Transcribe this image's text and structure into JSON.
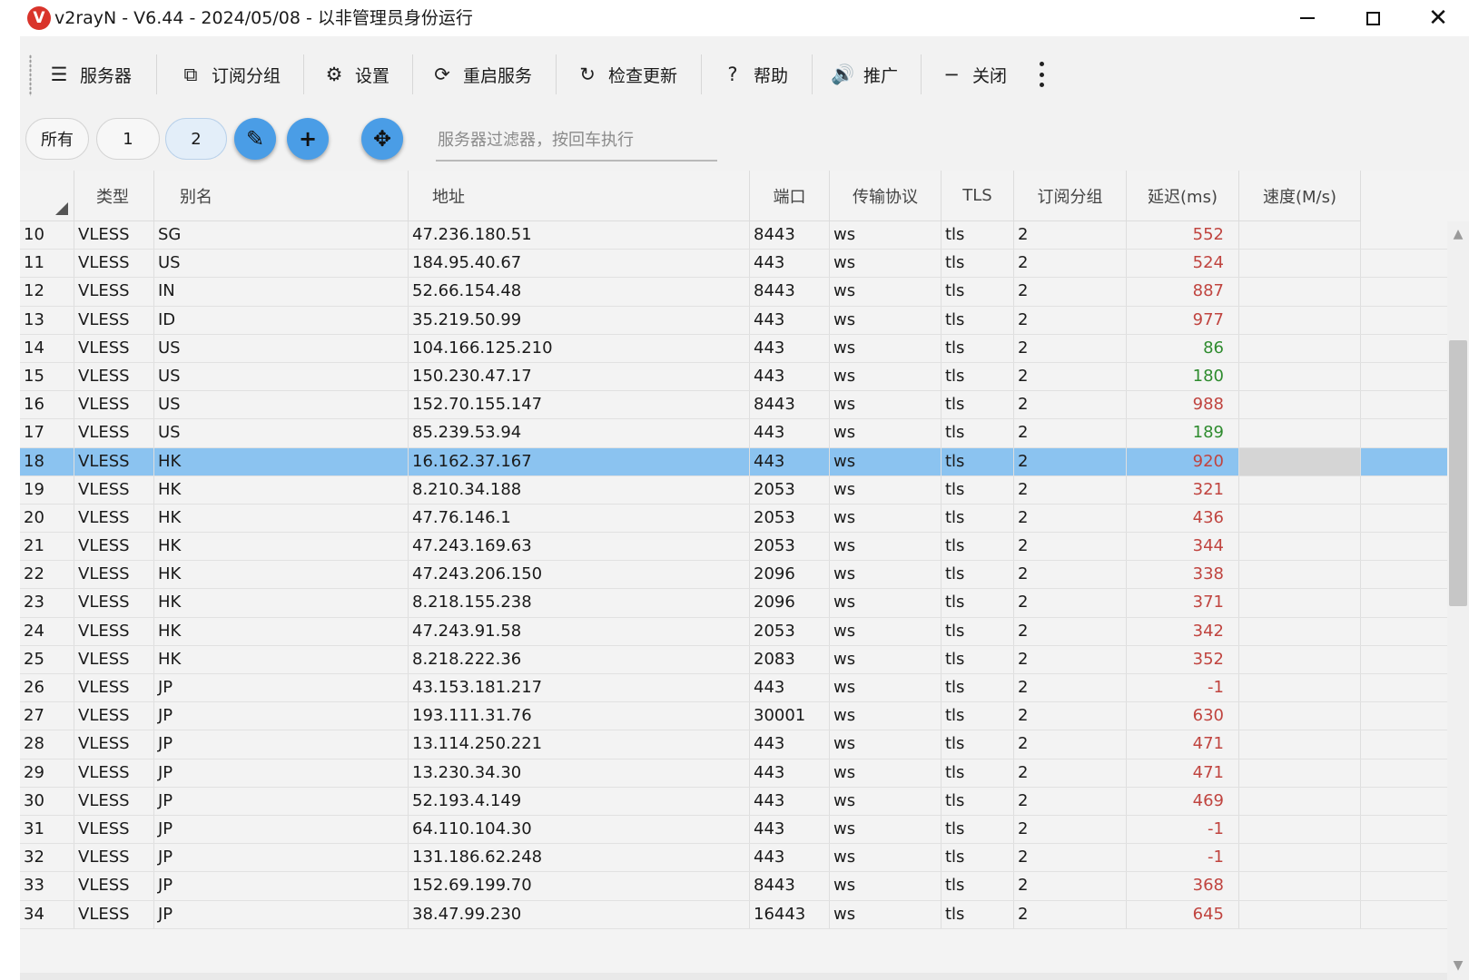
{
  "window": {
    "logo_letter": "V",
    "title": "v2rayN - V6.44 - 2024/05/08 - 以非管理员身份运行",
    "minimize_glyph": "",
    "close_glyph": "✕"
  },
  "toolbar": {
    "items": [
      {
        "icon": "server-list-icon",
        "glyph": "☰",
        "label": "服务器"
      },
      {
        "icon": "subscription-icon",
        "glyph": "⧉",
        "label": "订阅分组"
      },
      {
        "icon": "gear-icon",
        "glyph": "⚙",
        "label": "设置"
      },
      {
        "icon": "restart-icon",
        "glyph": "⟳",
        "label": "重启服务"
      },
      {
        "icon": "check-update-icon",
        "glyph": "↻",
        "label": "检查更新"
      },
      {
        "icon": "help-icon",
        "glyph": "?",
        "label": "帮助"
      },
      {
        "icon": "speaker-icon",
        "glyph": "🔊",
        "label": "推广"
      },
      {
        "icon": "minus-icon",
        "glyph": "−",
        "label": "关闭"
      }
    ],
    "more_icon": "more-vertical-icon"
  },
  "filters": {
    "chips": [
      "所有",
      "1",
      "2"
    ],
    "active_chip": "2",
    "edit_glyph": "✎",
    "add_glyph": "+",
    "move_glyph": "✥",
    "search_placeholder": "服务器过滤器，按回车执行",
    "search_value": ""
  },
  "table": {
    "columns": [
      "",
      "类型",
      "别名",
      "地址",
      "端口",
      "传输协议",
      "TLS",
      "订阅分组",
      "延迟(ms)",
      "速度(M/s)"
    ],
    "selected_index": "18",
    "rows": [
      {
        "idx": "10",
        "type": "VLESS",
        "alias": "SG",
        "address": "47.236.180.51",
        "port": "8443",
        "transport": "ws",
        "tls": "tls",
        "group": "2",
        "delay": "552",
        "speed": ""
      },
      {
        "idx": "11",
        "type": "VLESS",
        "alias": "US",
        "address": "184.95.40.67",
        "port": "443",
        "transport": "ws",
        "tls": "tls",
        "group": "2",
        "delay": "524",
        "speed": ""
      },
      {
        "idx": "12",
        "type": "VLESS",
        "alias": "IN",
        "address": "52.66.154.48",
        "port": "8443",
        "transport": "ws",
        "tls": "tls",
        "group": "2",
        "delay": "887",
        "speed": ""
      },
      {
        "idx": "13",
        "type": "VLESS",
        "alias": "ID",
        "address": "35.219.50.99",
        "port": "443",
        "transport": "ws",
        "tls": "tls",
        "group": "2",
        "delay": "977",
        "speed": ""
      },
      {
        "idx": "14",
        "type": "VLESS",
        "alias": "US",
        "address": "104.166.125.210",
        "port": "443",
        "transport": "ws",
        "tls": "tls",
        "group": "2",
        "delay": "86",
        "speed": ""
      },
      {
        "idx": "15",
        "type": "VLESS",
        "alias": "US",
        "address": "150.230.47.17",
        "port": "443",
        "transport": "ws",
        "tls": "tls",
        "group": "2",
        "delay": "180",
        "speed": ""
      },
      {
        "idx": "16",
        "type": "VLESS",
        "alias": "US",
        "address": "152.70.155.147",
        "port": "8443",
        "transport": "ws",
        "tls": "tls",
        "group": "2",
        "delay": "988",
        "speed": ""
      },
      {
        "idx": "17",
        "type": "VLESS",
        "alias": "US",
        "address": "85.239.53.94",
        "port": "443",
        "transport": "ws",
        "tls": "tls",
        "group": "2",
        "delay": "189",
        "speed": ""
      },
      {
        "idx": "18",
        "type": "VLESS",
        "alias": "HK",
        "address": "16.162.37.167",
        "port": "443",
        "transport": "ws",
        "tls": "tls",
        "group": "2",
        "delay": "920",
        "speed": ""
      },
      {
        "idx": "19",
        "type": "VLESS",
        "alias": "HK",
        "address": "8.210.34.188",
        "port": "2053",
        "transport": "ws",
        "tls": "tls",
        "group": "2",
        "delay": "321",
        "speed": ""
      },
      {
        "idx": "20",
        "type": "VLESS",
        "alias": "HK",
        "address": "47.76.146.1",
        "port": "2053",
        "transport": "ws",
        "tls": "tls",
        "group": "2",
        "delay": "436",
        "speed": ""
      },
      {
        "idx": "21",
        "type": "VLESS",
        "alias": "HK",
        "address": "47.243.169.63",
        "port": "2053",
        "transport": "ws",
        "tls": "tls",
        "group": "2",
        "delay": "344",
        "speed": ""
      },
      {
        "idx": "22",
        "type": "VLESS",
        "alias": "HK",
        "address": "47.243.206.150",
        "port": "2096",
        "transport": "ws",
        "tls": "tls",
        "group": "2",
        "delay": "338",
        "speed": ""
      },
      {
        "idx": "23",
        "type": "VLESS",
        "alias": "HK",
        "address": "8.218.155.238",
        "port": "2096",
        "transport": "ws",
        "tls": "tls",
        "group": "2",
        "delay": "371",
        "speed": ""
      },
      {
        "idx": "24",
        "type": "VLESS",
        "alias": "HK",
        "address": "47.243.91.58",
        "port": "2053",
        "transport": "ws",
        "tls": "tls",
        "group": "2",
        "delay": "342",
        "speed": ""
      },
      {
        "idx": "25",
        "type": "VLESS",
        "alias": "HK",
        "address": "8.218.222.36",
        "port": "2083",
        "transport": "ws",
        "tls": "tls",
        "group": "2",
        "delay": "352",
        "speed": ""
      },
      {
        "idx": "26",
        "type": "VLESS",
        "alias": "JP",
        "address": "43.153.181.217",
        "port": "443",
        "transport": "ws",
        "tls": "tls",
        "group": "2",
        "delay": "-1",
        "speed": ""
      },
      {
        "idx": "27",
        "type": "VLESS",
        "alias": "JP",
        "address": "193.111.31.76",
        "port": "30001",
        "transport": "ws",
        "tls": "tls",
        "group": "2",
        "delay": "630",
        "speed": ""
      },
      {
        "idx": "28",
        "type": "VLESS",
        "alias": "JP",
        "address": "13.114.250.221",
        "port": "443",
        "transport": "ws",
        "tls": "tls",
        "group": "2",
        "delay": "471",
        "speed": ""
      },
      {
        "idx": "29",
        "type": "VLESS",
        "alias": "JP",
        "address": "13.230.34.30",
        "port": "443",
        "transport": "ws",
        "tls": "tls",
        "group": "2",
        "delay": "471",
        "speed": ""
      },
      {
        "idx": "30",
        "type": "VLESS",
        "alias": "JP",
        "address": "52.193.4.149",
        "port": "443",
        "transport": "ws",
        "tls": "tls",
        "group": "2",
        "delay": "469",
        "speed": ""
      },
      {
        "idx": "31",
        "type": "VLESS",
        "alias": "JP",
        "address": "64.110.104.30",
        "port": "443",
        "transport": "ws",
        "tls": "tls",
        "group": "2",
        "delay": "-1",
        "speed": ""
      },
      {
        "idx": "32",
        "type": "VLESS",
        "alias": "JP",
        "address": "131.186.62.248",
        "port": "443",
        "transport": "ws",
        "tls": "tls",
        "group": "2",
        "delay": "-1",
        "speed": ""
      },
      {
        "idx": "33",
        "type": "VLESS",
        "alias": "JP",
        "address": "152.69.199.70",
        "port": "8443",
        "transport": "ws",
        "tls": "tls",
        "group": "2",
        "delay": "368",
        "speed": ""
      },
      {
        "idx": "34",
        "type": "VLESS",
        "alias": "JP",
        "address": "38.47.99.230",
        "port": "16443",
        "transport": "ws",
        "tls": "tls",
        "group": "2",
        "delay": "645",
        "speed": ""
      }
    ]
  },
  "colors": {
    "accent": "#4a9de6",
    "selected_row": "#8bc3f0",
    "delay_slow": "#c0443f",
    "delay_fast": "#2e8b2e"
  }
}
